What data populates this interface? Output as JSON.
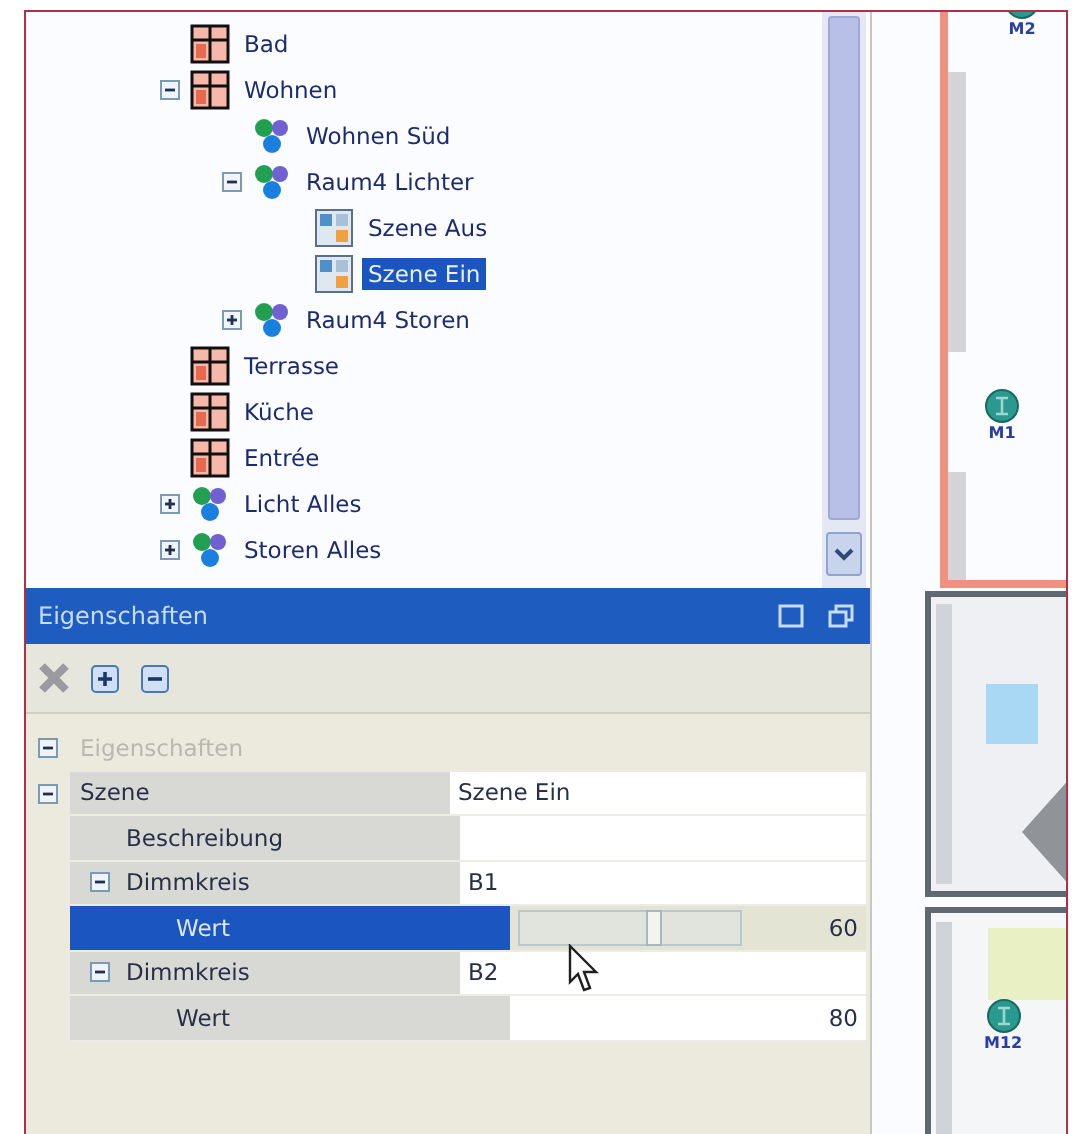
{
  "tree": {
    "items": [
      {
        "label": "Bad",
        "kind": "room",
        "selected": false
      },
      {
        "label": "Wohnen",
        "kind": "room",
        "selected": false,
        "expanded": true,
        "children": [
          {
            "label": "Wohnen Süd",
            "kind": "group",
            "selected": false
          },
          {
            "label": "Raum4 Lichter",
            "kind": "group",
            "selected": false,
            "expanded": true,
            "children": [
              {
                "label": "Szene Aus",
                "kind": "scene",
                "selected": false
              },
              {
                "label": "Szene Ein",
                "kind": "scene",
                "selected": true
              }
            ]
          },
          {
            "label": "Raum4 Storen",
            "kind": "group",
            "selected": false,
            "expanded": false
          }
        ]
      },
      {
        "label": "Terrasse",
        "kind": "room",
        "selected": false
      },
      {
        "label": "Küche",
        "kind": "room",
        "selected": false
      },
      {
        "label": "Entrée",
        "kind": "room",
        "selected": false
      },
      {
        "label": "Licht Alles",
        "kind": "group",
        "selected": false,
        "expanded": false
      },
      {
        "label": "Storen Alles",
        "kind": "group",
        "selected": false,
        "expanded": false
      }
    ]
  },
  "properties": {
    "title": "Eigenschaften",
    "rows": [
      {
        "label": "Eigenschaften",
        "kind": "category",
        "selected": false,
        "expanded": true,
        "children": [
          {
            "label": "Szene",
            "kind": "text",
            "value": "Szene Ein",
            "selected": false,
            "expanded": true,
            "children": [
              {
                "label": "Beschreibung",
                "kind": "text",
                "selected": false
              },
              {
                "label": "Dimmkreis",
                "kind": "text",
                "value": "B1",
                "selected": false,
                "expanded": true,
                "children": [
                  {
                    "label": "Wert",
                    "kind": "number",
                    "value": "60",
                    "level": 0.6,
                    "selected": true
                  }
                ]
              },
              {
                "label": "Dimmkreis",
                "kind": "text",
                "value": "B2",
                "selected": false,
                "expanded": true,
                "children": [
                  {
                    "label": "Wert",
                    "kind": "number",
                    "value": "80",
                    "selected": false
                  }
                ]
              }
            ]
          }
        ]
      }
    ]
  },
  "floor_plan": {
    "markers": [
      "M2",
      "M1",
      "M12"
    ]
  }
}
